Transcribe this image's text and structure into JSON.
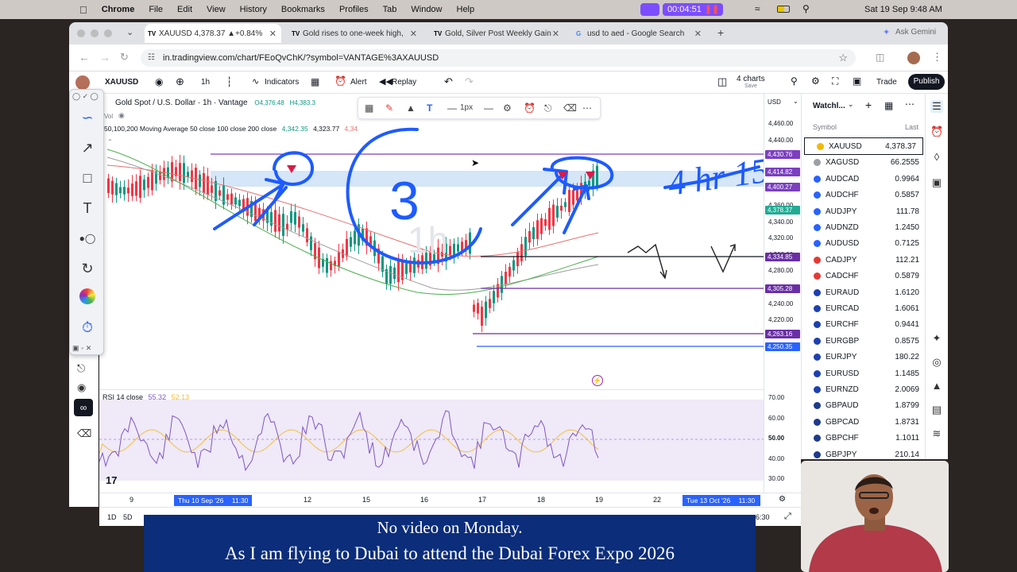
{
  "menubar": {
    "app": "Chrome",
    "items": [
      "File",
      "Edit",
      "View",
      "History",
      "Bookmarks",
      "Profiles",
      "Tab",
      "Window",
      "Help"
    ],
    "recording_time": "00:04:51",
    "datetime": "Sat 19 Sep  9:48 AM"
  },
  "tabs": [
    {
      "label": "XAUUSD 4,378.37 ▲+0.84%",
      "icon": "TV"
    },
    {
      "label": "Gold rises to one-week high,",
      "icon": "TV"
    },
    {
      "label": "Gold, Silver Post Weekly Gain",
      "icon": "TV"
    },
    {
      "label": "usd to aed - Google Search",
      "icon": "G"
    }
  ],
  "ask_gemini": "Ask Gemini",
  "url": "in.tradingview.com/chart/FEoQvChK/?symbol=VANTAGE%3AXAUUSD",
  "toolbar": {
    "symbol": "XAUUSD",
    "interval": "1h",
    "indicators": "Indicators",
    "alert": "Alert",
    "replay": "Replay",
    "layout_count": "4 charts",
    "layout_sub": "Save",
    "trade": "Trade",
    "publish": "Publish"
  },
  "chart": {
    "title": "Gold Spot / U.S. Dollar · 1h · Vantage",
    "ohlc_o": "O4,376.48",
    "ohlc_h": "H4,383.3",
    "ma_label": "50,100,200 Moving Average 50 close 100 close 200 close",
    "ma_v1": "4,342.35",
    "ma_v2": "4,323.77",
    "ma_v3": "4,34",
    "vol": "Vol",
    "watermark": "1h",
    "stroke_label": "1px",
    "currency": "USD",
    "annotation_circle": "3",
    "annotation_text": "4 hr 15"
  },
  "yaxis": {
    "labels": [
      "4,460.00",
      "4,440.00",
      "4,420.00",
      "4,400.00",
      "4,380.00",
      "4,360.00",
      "4,340.00",
      "4,320.00",
      "4,300.00",
      "4,280.00",
      "4,260.00",
      "4,240.00",
      "4,220.00"
    ],
    "tags": [
      {
        "text": "4,430.76",
        "color": "#7b3fbf"
      },
      {
        "text": "4,414.82",
        "color": "#7b3fbf"
      },
      {
        "text": "4,400.27",
        "color": "#7b3fbf"
      },
      {
        "text": "4,378.37",
        "color": "#22ab94"
      },
      {
        "text": "4,334.85",
        "color": "#6a2fa5"
      },
      {
        "text": "4,305.28",
        "color": "#6a2fa5"
      },
      {
        "text": "4,263.16",
        "color": "#6a2fa5"
      },
      {
        "text": "4,250.35",
        "color": "#2962ff"
      }
    ],
    "rsi_labels": [
      "70.00",
      "60.00",
      "50.00",
      "40.00",
      "30.00"
    ]
  },
  "rsi": {
    "label": "RSI 14 close",
    "v1": "55.32",
    "v2": "52.13"
  },
  "xaxis": {
    "labels": [
      "9",
      "12",
      "15",
      "16",
      "17",
      "18",
      "19",
      "22"
    ],
    "left_tag": "Thu 10 Sep '26",
    "left_time": "11:30",
    "right_tag": "Tue 13 Oct '26",
    "right_time": "11:30"
  },
  "bottom": {
    "ranges": [
      "1D",
      "5D"
    ],
    "time": "6:30"
  },
  "watchlist": {
    "title": "Watchl...",
    "col_symbol": "Symbol",
    "col_last": "Last",
    "rows": [
      {
        "symbol": "XAUUSD",
        "last": "4,378.37",
        "color": "#f0b90b"
      },
      {
        "symbol": "XAGUSD",
        "last": "66.2555",
        "color": "#9aa0a6"
      },
      {
        "symbol": "AUDCAD",
        "last": "0.9964",
        "color": "#2962ff"
      },
      {
        "symbol": "AUDCHF",
        "last": "0.5857",
        "color": "#2962ff"
      },
      {
        "symbol": "AUDJPY",
        "last": "111.78",
        "color": "#2962ff"
      },
      {
        "symbol": "AUDNZD",
        "last": "1.2450",
        "color": "#2962ff"
      },
      {
        "symbol": "AUDUSD",
        "last": "0.7125",
        "color": "#2962ff"
      },
      {
        "symbol": "CADJPY",
        "last": "112.21",
        "color": "#e53935"
      },
      {
        "symbol": "CADCHF",
        "last": "0.5879",
        "color": "#e53935"
      },
      {
        "symbol": "EURAUD",
        "last": "1.6120",
        "color": "#1e40af"
      },
      {
        "symbol": "EURCAD",
        "last": "1.6061",
        "color": "#1e40af"
      },
      {
        "symbol": "EURCHF",
        "last": "0.9441",
        "color": "#1e40af"
      },
      {
        "symbol": "EURGBP",
        "last": "0.8575",
        "color": "#1e40af"
      },
      {
        "symbol": "EURJPY",
        "last": "180.22",
        "color": "#1e40af"
      },
      {
        "symbol": "EURUSD",
        "last": "1.1485",
        "color": "#1e40af"
      },
      {
        "symbol": "EURNZD",
        "last": "2.0069",
        "color": "#1e40af"
      },
      {
        "symbol": "GBPAUD",
        "last": "1.8799",
        "color": "#1e3a8a"
      },
      {
        "symbol": "GBPCAD",
        "last": "1.8731",
        "color": "#1e3a8a"
      },
      {
        "symbol": "GBPCHF",
        "last": "1.1011",
        "color": "#1e3a8a"
      },
      {
        "symbol": "GBPJPY",
        "last": "210.14",
        "color": "#1e3a8a"
      }
    ]
  },
  "caption": {
    "line1": "No video on Monday.",
    "line2": "As I am flying to Dubai to attend the Dubai Forex Expo 2026"
  }
}
